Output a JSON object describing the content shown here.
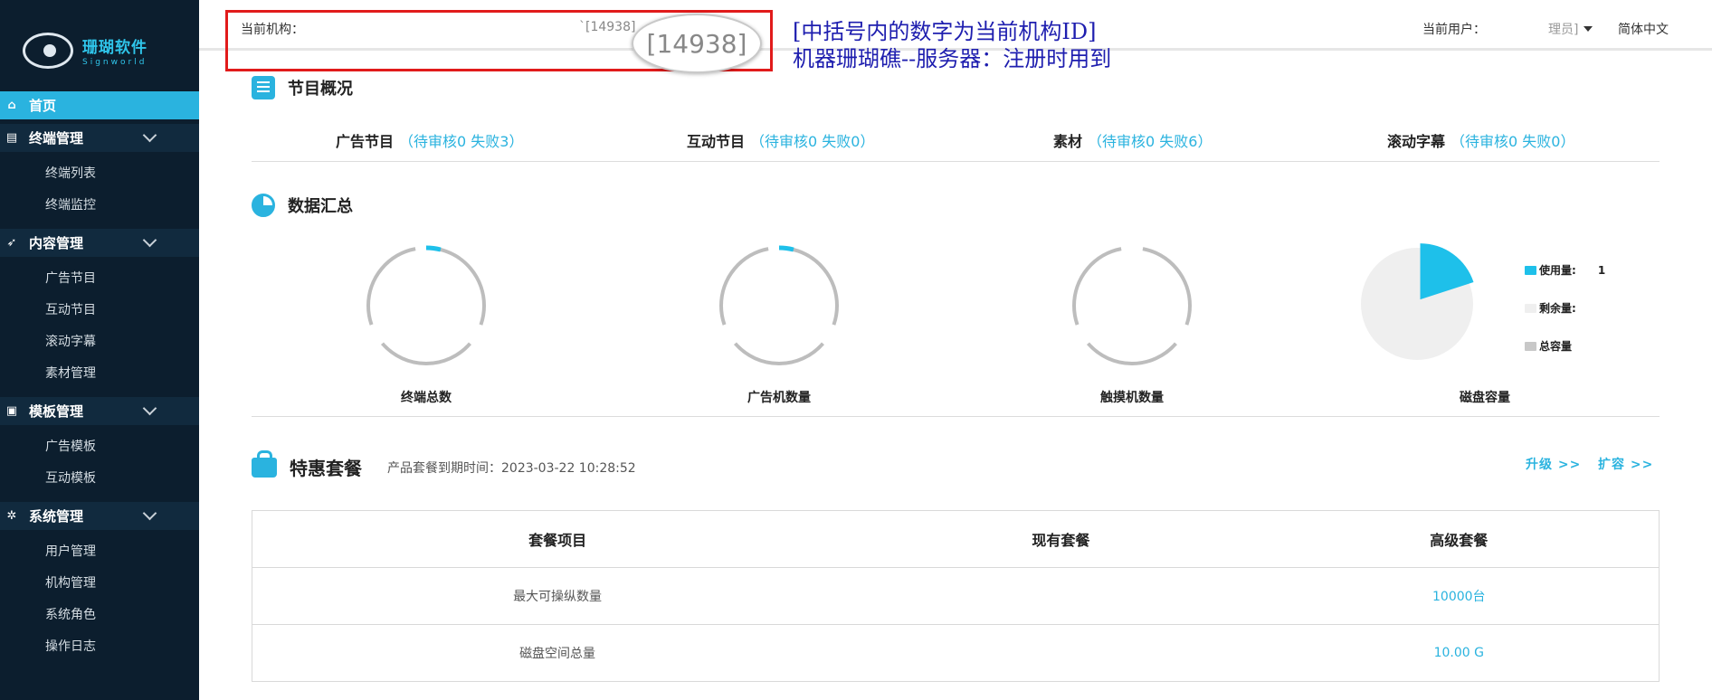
{
  "brand": {
    "name_cn": "珊瑚软件",
    "name_en": "Signworld"
  },
  "sidebar": {
    "home": "首页",
    "groups": [
      {
        "label": "终端管理",
        "icon": "terminal-icon",
        "items": [
          "终端列表",
          "终端监控"
        ]
      },
      {
        "label": "内容管理",
        "icon": "send-icon",
        "items": [
          "广告节目",
          "互动节目",
          "滚动字幕",
          "素材管理"
        ]
      },
      {
        "label": "模板管理",
        "icon": "template-icon",
        "items": [
          "广告模板",
          "互动模板"
        ]
      },
      {
        "label": "系统管理",
        "icon": "gear-icon",
        "items": [
          "用户管理",
          "机构管理",
          "系统角色",
          "操作日志"
        ]
      }
    ]
  },
  "header": {
    "org_label": "当前机构：",
    "org_id": "`[14938]",
    "user_label": "当前用户：",
    "user_value": "理员]",
    "language": "简体中文"
  },
  "annotation": {
    "zoom_text": "[14938]",
    "line1": "[中括号内的数字为当前机构ID]",
    "line2": "机器珊瑚礁--服务器：注册时用到"
  },
  "overview": {
    "title": "节目概况",
    "items": [
      {
        "label": "广告节目",
        "stat": "（待审核0  失败3）"
      },
      {
        "label": "互动节目",
        "stat": "（待审核0  失败0）"
      },
      {
        "label": "素材",
        "stat": "（待审核0  失败6）"
      },
      {
        "label": "滚动字幕",
        "stat": "（待审核0  失败0）"
      }
    ]
  },
  "summary": {
    "title": "数据汇总",
    "gauges": [
      {
        "label": "终端总数",
        "fraction": 0.04
      },
      {
        "label": "广告机数量",
        "fraction": 0.04
      },
      {
        "label": "触摸机数量",
        "fraction": 0
      }
    ],
    "disk": {
      "label": "磁盘容量",
      "used_fraction": 0.2,
      "legend": [
        {
          "label": "使用量:",
          "value": "1",
          "color": "#1ec0ea"
        },
        {
          "label": "剩余量:",
          "value": "",
          "color": "#efefef"
        },
        {
          "label": "总容量",
          "value": "",
          "color": "#c8c8c8"
        }
      ]
    }
  },
  "package": {
    "title": "特惠套餐",
    "expire_label": "产品套餐到期时间：",
    "expire_value": "2023-03-22 10:28:52",
    "upgrade": "升级 >>",
    "expand": "扩容 >>",
    "columns": [
      "套餐项目",
      "现有套餐",
      "高级套餐"
    ],
    "rows": [
      {
        "item": "最大可操纵数量",
        "current": "",
        "advanced": "10000台"
      },
      {
        "item": "磁盘空间总量",
        "current": "",
        "advanced": "10.00 G"
      }
    ]
  },
  "colors": {
    "accent": "#2ab3df",
    "sidebar_bg": "#0c1e2e",
    "annotation_red": "#e11b1b",
    "annotation_blue": "#1e1eaf"
  }
}
